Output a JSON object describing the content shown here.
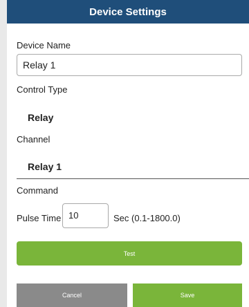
{
  "header": {
    "title": "Device Settings"
  },
  "form": {
    "device_name_label": "Device Name",
    "device_name_value": "Relay 1",
    "control_type_label": "Control Type",
    "control_type_value": "Relay",
    "channel_label": "Channel",
    "channel_value": "Relay 1",
    "command_label": "Command",
    "pulse_time_label": "Pulse Time",
    "pulse_time_value": "10",
    "pulse_time_range": "Sec (0.1-1800.0)"
  },
  "buttons": {
    "test_label": "Test",
    "cancel_label": "Cancel",
    "save_label": "Save"
  },
  "colors": {
    "header_bg": "#1f4e7a",
    "green": "#7ab53a",
    "gray": "#8a8a8a"
  }
}
